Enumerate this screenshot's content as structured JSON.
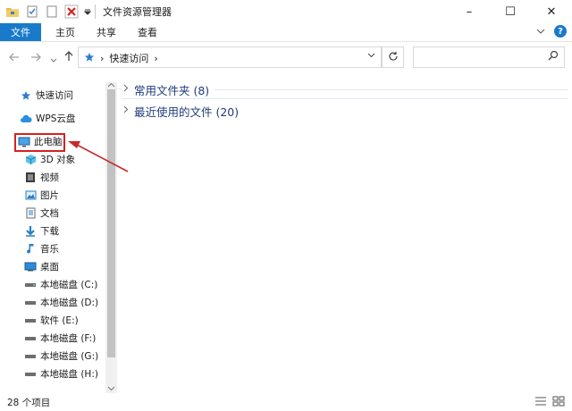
{
  "window": {
    "title": "文件资源管理器",
    "controls": {
      "minimize": "–",
      "maximize": "☐",
      "close": "✕"
    }
  },
  "ribbon": {
    "tabs": [
      {
        "label": "文件",
        "active": true
      },
      {
        "label": "主页"
      },
      {
        "label": "共享"
      },
      {
        "label": "查看"
      }
    ],
    "help": "?"
  },
  "address": {
    "breadcrumb_icon": "pin-icon",
    "location": "快速访问",
    "separator": "›"
  },
  "search": {
    "placeholder": ""
  },
  "sidebar": {
    "items": [
      {
        "label": "快速访问",
        "icon": "star-pin-icon"
      },
      {
        "label": "WPS云盘",
        "icon": "cloud-icon"
      },
      {
        "label": "此电脑",
        "icon": "computer-icon",
        "highlighted": true
      },
      {
        "label": "3D 对象",
        "icon": "cube-3d-icon"
      },
      {
        "label": "视频",
        "icon": "video-icon"
      },
      {
        "label": "图片",
        "icon": "picture-icon"
      },
      {
        "label": "文档",
        "icon": "document-icon"
      },
      {
        "label": "下载",
        "icon": "download-arrow-icon"
      },
      {
        "label": "音乐",
        "icon": "music-note-icon"
      },
      {
        "label": "桌面",
        "icon": "desktop-icon"
      },
      {
        "label": "本地磁盘 (C:)",
        "icon": "drive-icon"
      },
      {
        "label": "本地磁盘 (D:)",
        "icon": "drive-icon"
      },
      {
        "label": "软件 (E:)",
        "icon": "drive-icon"
      },
      {
        "label": "本地磁盘 (F:)",
        "icon": "drive-icon"
      },
      {
        "label": "本地磁盘 (G:)",
        "icon": "drive-icon"
      },
      {
        "label": "本地磁盘 (H:)",
        "icon": "drive-icon"
      }
    ]
  },
  "content": {
    "groups": [
      {
        "label": "常用文件夹 (8)"
      },
      {
        "label": "最近使用的文件 (20)"
      }
    ]
  },
  "statusbar": {
    "count": "28 个项目"
  },
  "colors": {
    "accent": "#1979ca",
    "highlight_border": "#d42222",
    "group_text": "#1e3b7a"
  }
}
